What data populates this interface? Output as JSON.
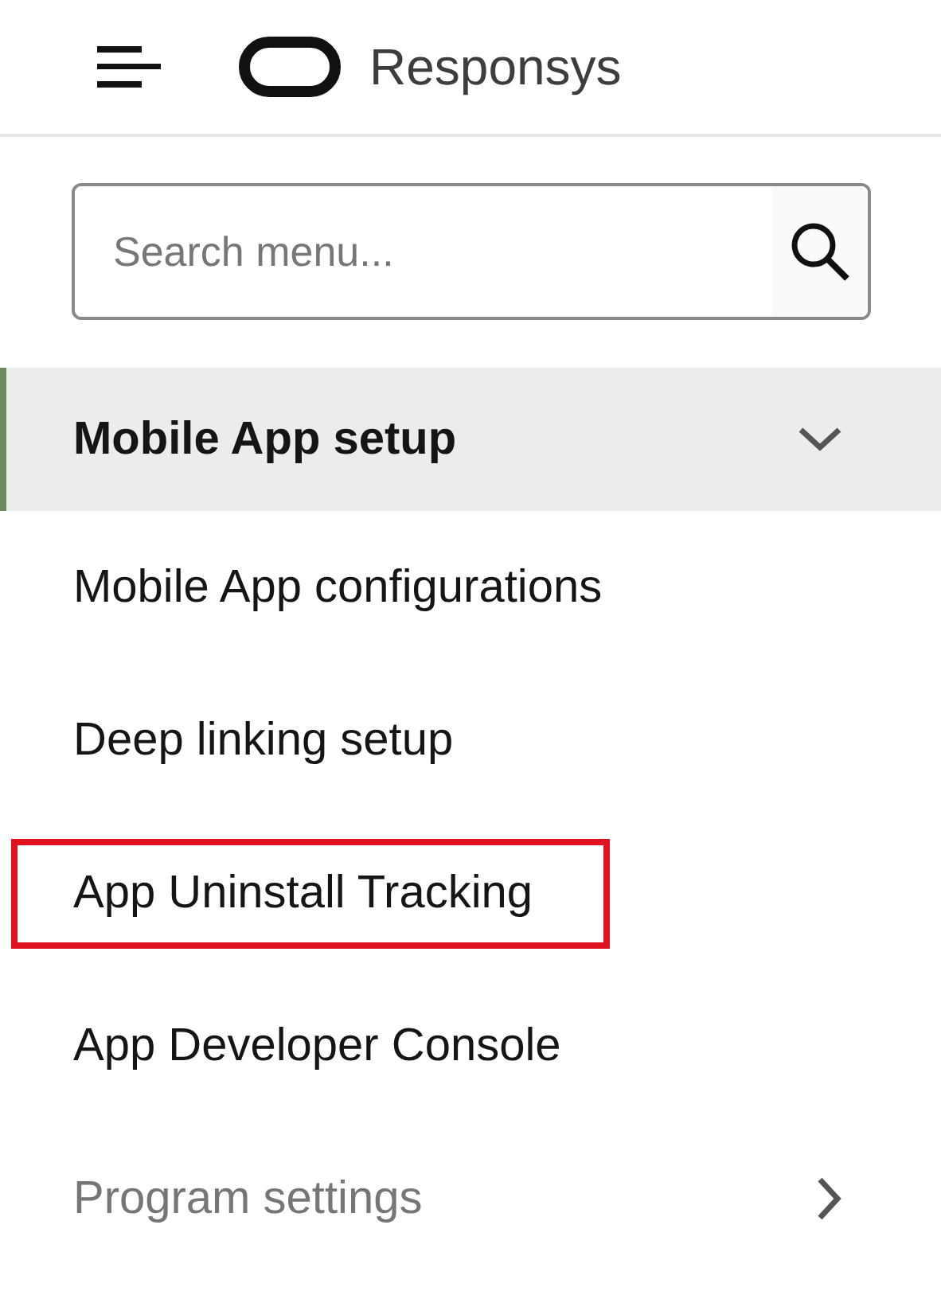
{
  "header": {
    "title": "Responsys"
  },
  "search": {
    "placeholder": "Search menu..."
  },
  "menu": [
    {
      "kind": "section",
      "label": "Mobile App setup",
      "expanded": true,
      "disabled": false
    },
    {
      "kind": "link",
      "label": "Mobile App configurations",
      "highlighted": false
    },
    {
      "kind": "link",
      "label": "Deep linking setup",
      "highlighted": false
    },
    {
      "kind": "link",
      "label": "App Uninstall Tracking",
      "highlighted": true
    },
    {
      "kind": "link",
      "label": "App Developer Console",
      "highlighted": false
    },
    {
      "kind": "section",
      "label": "Program settings",
      "expanded": false,
      "disabled": true
    }
  ]
}
